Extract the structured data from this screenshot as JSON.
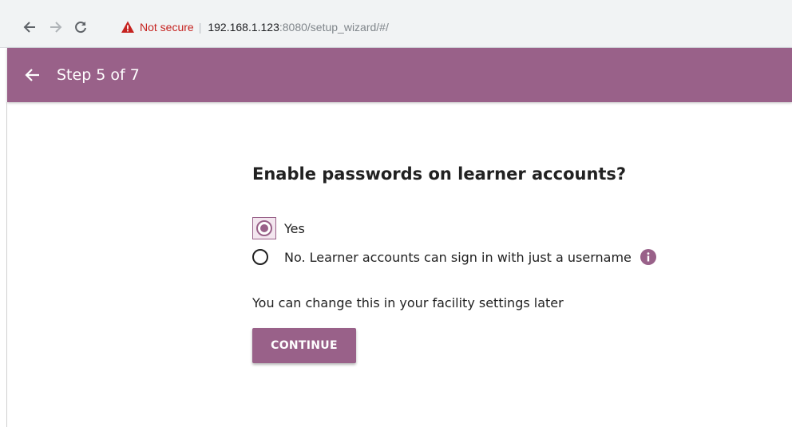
{
  "browser": {
    "security_label": "Not secure",
    "url_host": "192.168.1.123",
    "url_rest": ":8080/setup_wizard/#/"
  },
  "header": {
    "title": "Step 5 of 7",
    "color": "#996189"
  },
  "main": {
    "question": "Enable passwords on learner accounts?",
    "options": [
      {
        "label": "Yes",
        "selected": true
      },
      {
        "label": "No. Learner accounts can sign in with just a username",
        "selected": false
      }
    ],
    "note": "You can change this in your facility settings later",
    "continue_label": "CONTINUE"
  },
  "icons": {
    "back": "arrow-left-icon",
    "forward": "arrow-right-icon",
    "reload": "reload-icon",
    "warning": "warning-triangle-icon",
    "info": "info-icon"
  }
}
